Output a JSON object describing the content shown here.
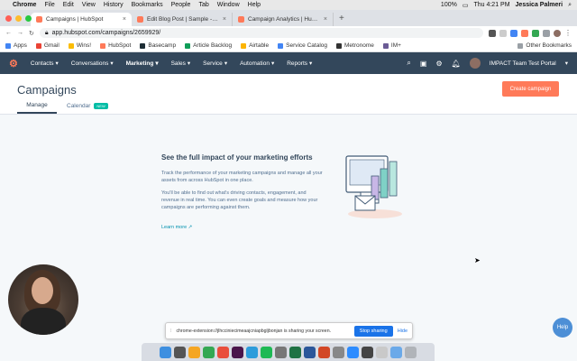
{
  "mac": {
    "app": "Chrome",
    "menus": [
      "File",
      "Edit",
      "View",
      "History",
      "Bookmarks",
      "People",
      "Tab",
      "Window",
      "Help"
    ],
    "battery": "100%",
    "clock": "Thu 4:21 PM",
    "user": "Jessica Palmeri"
  },
  "browser": {
    "tabs": [
      {
        "title": "Campaigns | HubSpot",
        "active": true
      },
      {
        "title": "Edit Blog Post | Sample - How",
        "active": false
      },
      {
        "title": "Campaign Analytics | HubSpot",
        "active": false
      }
    ],
    "url": "app.hubspot.com/campaigns/2659929/",
    "bookmarks": [
      "Apps",
      "Gmail",
      "Wins!",
      "HubSpot",
      "Basecamp",
      "Article Backlog",
      "Airtable",
      "Service Catalog",
      "Metronome",
      "IM+"
    ],
    "other_bookmarks": "Other Bookmarks"
  },
  "hubspot_nav": {
    "items": [
      "Contacts",
      "Conversations",
      "Marketing",
      "Sales",
      "Service",
      "Automation",
      "Reports"
    ],
    "active": "Marketing",
    "portal": "IMPACT Team Test Portal"
  },
  "page": {
    "title": "Campaigns",
    "create_button": "Create campaign",
    "tabs": {
      "manage": "Manage",
      "calendar": "Calendar",
      "calendar_badge": "NEW"
    }
  },
  "empty_state": {
    "heading": "See the full impact of your marketing efforts",
    "paragraph1": "Track the performance of your marketing campaigns and manage all your assets from across HubSpot in one place.",
    "paragraph2": "You'll be able to find out what's driving contacts, engagement, and revenue in real time. You can even create goals and measure how your campaigns are performing against them.",
    "learn_more": "Learn more"
  },
  "help_button": "Help",
  "share_bar": {
    "message": "chrome-extension://jlhcciniecimeaajcniapbgljbonjan is sharing your screen.",
    "stop": "Stop sharing",
    "hide": "Hide"
  },
  "colors": {
    "nav_bg": "#33475b",
    "accent": "#ff7a59",
    "badge": "#00bda5",
    "link": "#0091ae",
    "share_button": "#1a73e8"
  }
}
